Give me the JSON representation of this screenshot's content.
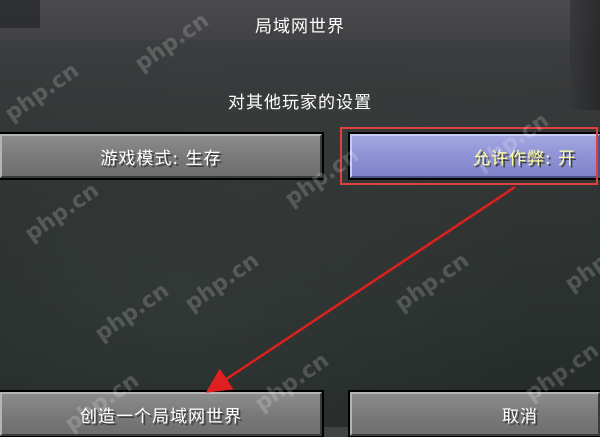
{
  "screen": {
    "title": "局域网世界",
    "subtitle": "对其他玩家的设置"
  },
  "buttons": {
    "game_mode": "游戏模式: 生存",
    "allow_cheats": "允许作弊: 开",
    "create_lan_world": "创造一个局域网世界",
    "cancel": "取消"
  },
  "watermark": {
    "text": "php.cn"
  },
  "annotation": {
    "highlight_color": "#e04040",
    "arrow_color": "#e02020"
  }
}
